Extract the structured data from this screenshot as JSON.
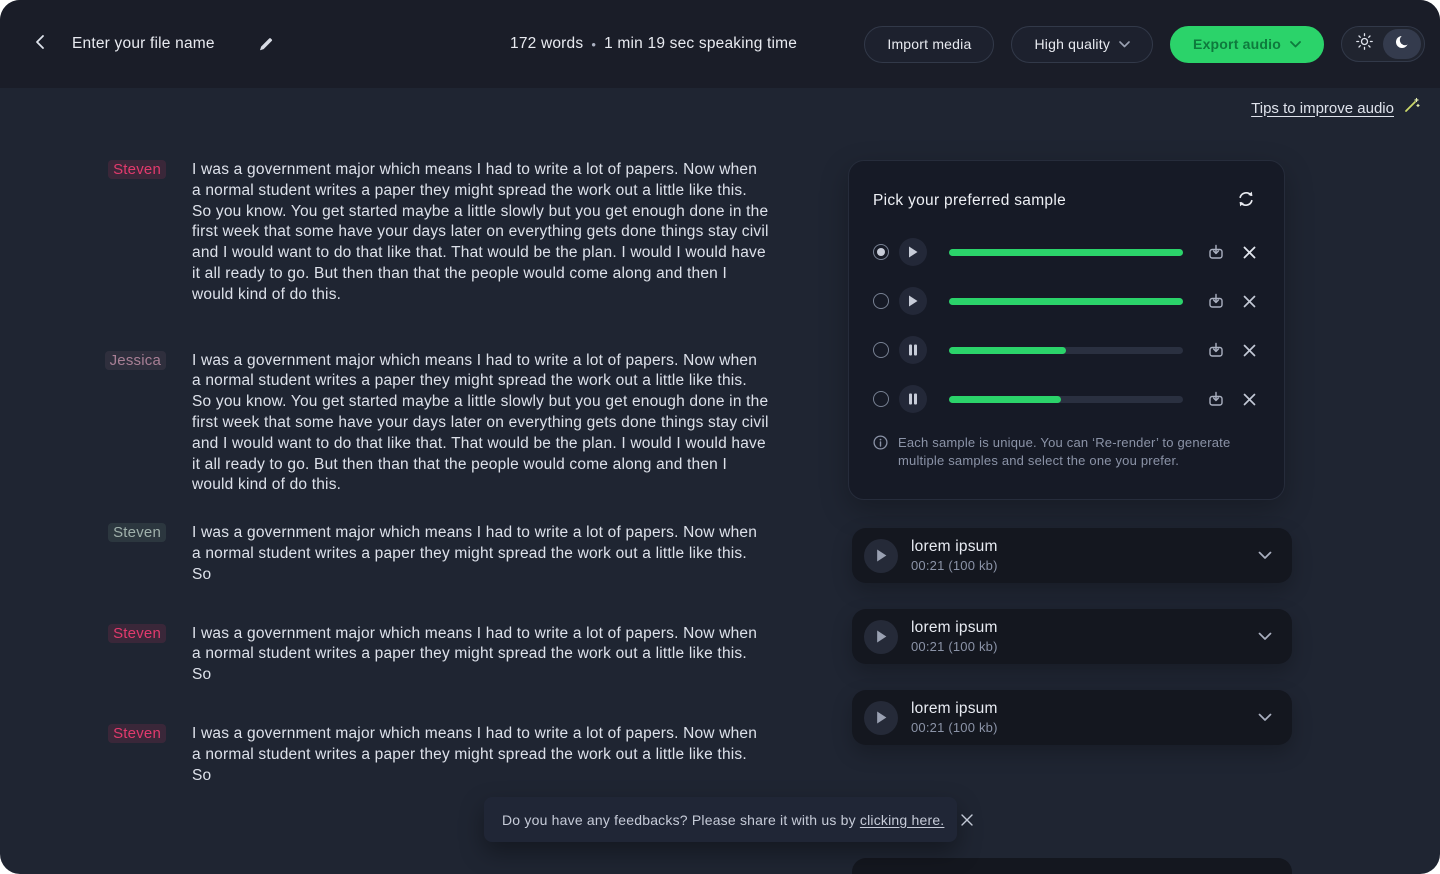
{
  "topbar": {
    "filename_placeholder": "Enter your file name",
    "stats": {
      "words": "172 words",
      "separator": "•",
      "speaking_time": "1 min 19 sec speaking time"
    },
    "import_media_label": "Import media",
    "quality_label": "High quality",
    "export_label": "Export audio"
  },
  "tips_link_label": "Tips to improve audio",
  "transcript": [
    {
      "speaker": "Steven",
      "text": "I was a government major which means I had to write a lot of papers. Now when a normal student writes a paper they might spread the work out a little like this. So you know. You get started maybe a little slowly but you get enough done in the first week that some have your days later on everything gets done things stay civil and I would want to do that like that. That would be the plan. I would I would have it all ready to go. But then than that the people would come along and then I would kind of do this."
    },
    {
      "speaker": "Jessica",
      "text": "I was a government major which means I had to write a lot of papers. Now when a normal student writes a paper they might spread the work out a little like this. So you know. You get started maybe a little slowly but you get enough done in the first week that some have your days later on everything gets done things stay civil and I would want to do that like that. That would be the plan. I would I would have it all ready to go. But then than that the people would come along and then I would kind of do this."
    },
    {
      "speaker": "Steven",
      "text": "I was a government major which means I had to write a lot of papers. Now when a normal student writes a paper they might spread the work out a little like this. So"
    },
    {
      "speaker": "Steven",
      "text": "I was a government major which means I had to write a lot of papers. Now when a normal student writes a paper they might spread the work out a little like this. So"
    },
    {
      "speaker": "Steven",
      "text": "I was a government major which means I had to write a lot of papers. Now when a normal student writes a paper they might spread the work out a little like this. So"
    }
  ],
  "samples": {
    "title": "Pick your preferred sample",
    "rows": [
      {
        "selected": true,
        "state": "play",
        "progress": "100%"
      },
      {
        "selected": false,
        "state": "play",
        "progress": "100%"
      },
      {
        "selected": false,
        "state": "pause",
        "progress": "50%"
      },
      {
        "selected": false,
        "state": "pause",
        "progress": "48%"
      }
    ],
    "note": "Each sample is unique. You can ‘Re-render’ to generate multiple samples and select the one you prefer."
  },
  "audio_cards": [
    {
      "title": "lorem ipsum",
      "meta": "00:21 (100 kb)"
    },
    {
      "title": "lorem ipsum",
      "meta": "00:21 (100 kb)"
    },
    {
      "title": "lorem ipsum",
      "meta": "00:21 (100 kb)"
    }
  ],
  "toast": {
    "message": "Do you have any feedbacks? Please share it with us by ",
    "link_label": "clicking here."
  },
  "colors": {
    "accent_green": "#2bd36a",
    "speaker_red": "#e23a6d",
    "page_bg": "#1f2532",
    "topbar_bg": "#1a1d28"
  }
}
